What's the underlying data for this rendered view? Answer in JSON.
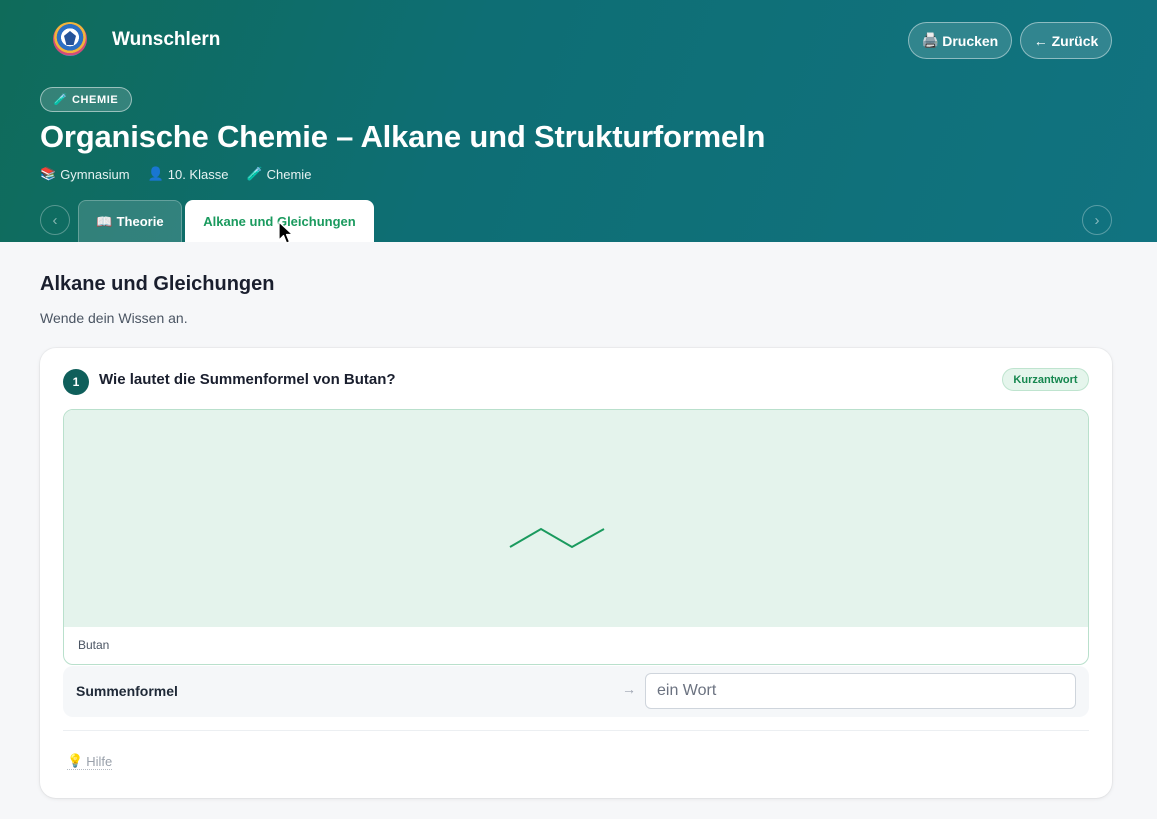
{
  "app": {
    "brand": "Wunschlern",
    "print_icon": "🖨️",
    "print_label": "Drucken",
    "back_label": "← Zurück"
  },
  "hero": {
    "badge_icon": "🧪",
    "badge_label": "CHEMIE",
    "title": "Organische Chemie – Alkane und Strukturformeln",
    "meta": [
      {
        "icon": "📚",
        "label": "Gymnasium"
      },
      {
        "icon": "👤",
        "label": "10. Klasse"
      },
      {
        "icon": "🧪",
        "label": "Chemie"
      }
    ],
    "nav_prev": "‹",
    "nav_next": "›"
  },
  "tabs": [
    {
      "icon": "📖",
      "label": "Theorie",
      "active": false
    },
    {
      "label": "Alkane und Gleichungen",
      "active": true
    }
  ],
  "section": {
    "title": "Alkane und Gleichungen",
    "subtitle": "Wende dein Wissen an."
  },
  "question": {
    "number": "1",
    "text": "Wie lautet die Summenformel von Butan?",
    "type": "Kurzantwort",
    "figure_caption": "Butan",
    "answer_label": "Summenformel",
    "answer_arrow": "→",
    "answer_placeholder": "ein Wort",
    "answer_value": "",
    "help_icon": "💡",
    "help_label": "Hilfe"
  },
  "colors": {
    "accent_green": "#1a9a5e",
    "header_start": "#0f6b5a",
    "header_end": "#117380",
    "figure_bg": "#e4f3ec"
  }
}
